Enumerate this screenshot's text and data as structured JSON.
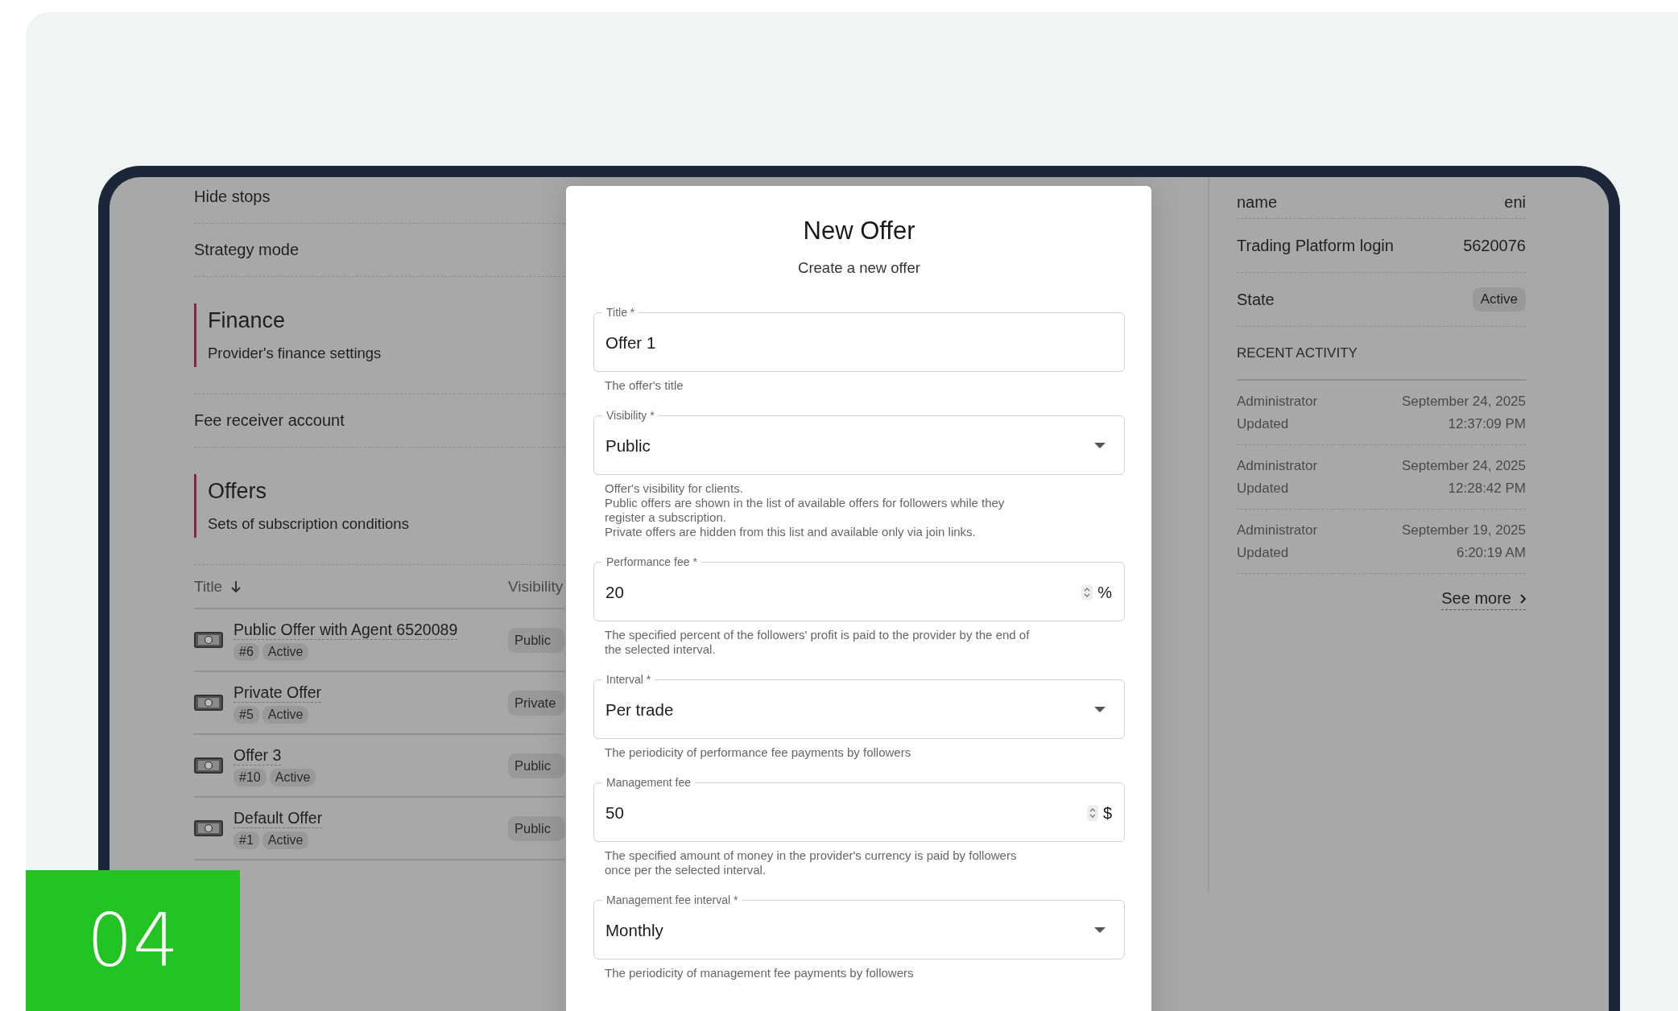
{
  "settings": {
    "items": [
      {
        "kind": "row",
        "label": "Hide stops"
      },
      {
        "kind": "row",
        "label": "Strategy mode"
      },
      {
        "kind": "section",
        "title": "Finance",
        "subtitle": "Provider's finance settings"
      },
      {
        "kind": "row",
        "label": "Fee receiver account"
      },
      {
        "kind": "section",
        "title": "Offers",
        "subtitle": "Sets of subscription conditions"
      }
    ]
  },
  "offers_table": {
    "columns": [
      {
        "label": "Title",
        "sorted": true
      },
      {
        "label": "Visibility",
        "sorted": false
      }
    ],
    "rows": [
      {
        "title": "Public Offer with Agent 6520089",
        "number": "#6",
        "state": "Active",
        "visibility": "Public"
      },
      {
        "title": "Private Offer",
        "number": "#5",
        "state": "Active",
        "visibility": "Private"
      },
      {
        "title": "Offer 3",
        "number": "#10",
        "state": "Active",
        "visibility": "Public"
      },
      {
        "title": "Default Offer",
        "number": "#1",
        "state": "Active",
        "visibility": "Public"
      }
    ]
  },
  "modal": {
    "title": "New Offer",
    "subtitle": "Create a new offer",
    "fields": [
      {
        "kind": "text",
        "label": "Title *",
        "value": "Offer 1",
        "helper": "The offer's title"
      },
      {
        "kind": "select",
        "label": "Visibility *",
        "value": "Public",
        "helper": "Offer's visibility for clients.\nPublic offers are shown in the list of available offers for followers while they\nregister a subscription.\nPrivate offers are hidden from this list and available only via join links."
      },
      {
        "kind": "number",
        "label": "Performance fee *",
        "value": "20",
        "unit": "%",
        "helper": "The specified percent of the followers' profit is paid to the provider by the end of\nthe selected interval."
      },
      {
        "kind": "select",
        "label": "Interval *",
        "value": "Per trade",
        "helper": "The periodicity of performance fee payments by followers"
      },
      {
        "kind": "number",
        "label": "Management fee",
        "value": "50",
        "unit": "$",
        "helper": "The specified amount of money in the provider's currency is paid by followers\nonce per the selected interval."
      },
      {
        "kind": "select",
        "label": "Management fee interval *",
        "value": "Monthly",
        "helper": "The periodicity of management fee payments by followers"
      }
    ]
  },
  "details": {
    "rows": [
      {
        "kind": "text",
        "label": "name",
        "value": "eni"
      },
      {
        "kind": "text",
        "label": "Trading Platform login",
        "value": "5620076"
      },
      {
        "kind": "chip",
        "label": "State",
        "value": "Active"
      }
    ],
    "activity_title": "RECENT ACTIVITY",
    "activity": [
      {
        "user": "Administrator",
        "action": "Updated",
        "date": "September 24, 2025",
        "time": "12:37:09 PM"
      },
      {
        "user": "Administrator",
        "action": "Updated",
        "date": "September 24, 2025",
        "time": "12:28:42 PM"
      },
      {
        "user": "Administrator",
        "action": "Updated",
        "date": "September 19, 2025",
        "time": "6:20:19 AM"
      }
    ],
    "see_more": "See more"
  },
  "badge": {
    "label": "04"
  }
}
